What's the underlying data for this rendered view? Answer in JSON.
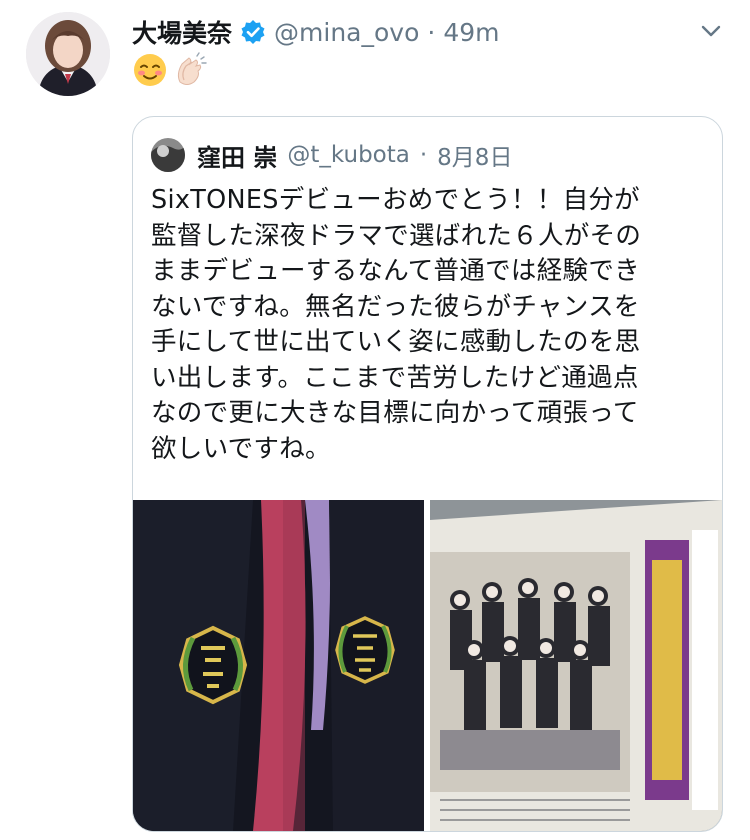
{
  "tweet": {
    "author_name": "大場美奈",
    "author_handle": "@mina_ovo",
    "separator": "·",
    "time": "49m",
    "verified_icon": "verified-badge-icon",
    "emojis": [
      "relieved-face-icon",
      "clapping-hands-icon"
    ]
  },
  "quoted": {
    "author_name": "窪田 崇",
    "author_handle": "@t_kubota",
    "separator": "·",
    "date": "8月8日",
    "text": "SixTONESデビューおめでとう！！自分が\n監督した深夜ドラマで選ばれた６人がその\nままデビューするなんて普通では経験でき\nないですね。無名だった彼らがチャンスを\n手にして世に出ていく姿に感動したのを思\nい出します。ここまで苦労したけど通過点\nなので更に大きな目標に向かって頑張って\n欲しいですね。",
    "media": [
      {
        "kind": "photo",
        "subject": "school-uniform-emblem-photo"
      },
      {
        "kind": "photo",
        "subject": "newspaper-clipping-photo"
      }
    ]
  },
  "colors": {
    "text": "#14171a",
    "secondary": "#657786",
    "verified_blue": "#1da1f2",
    "border": "#ccd6dd"
  }
}
